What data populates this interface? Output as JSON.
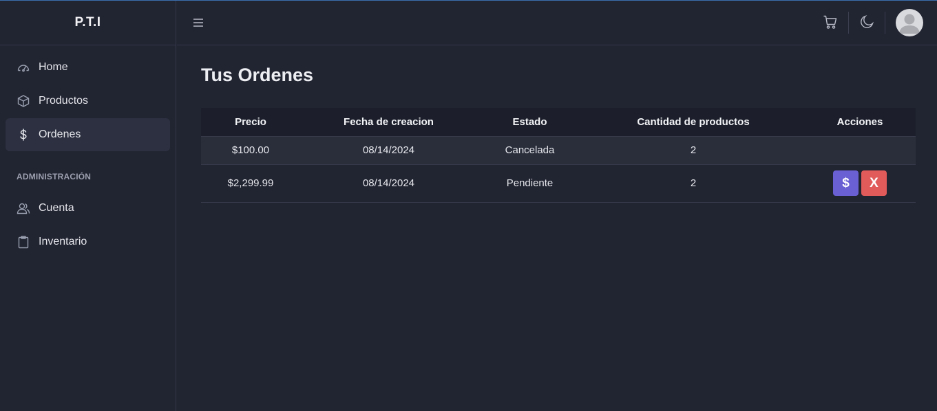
{
  "brand": "P.T.I",
  "sidebar": {
    "items": [
      {
        "label": "Home",
        "icon": "dashboard-gauge-icon",
        "active": false
      },
      {
        "label": "Productos",
        "icon": "cube-icon",
        "active": false
      },
      {
        "label": "Ordenes",
        "icon": "dollar-icon",
        "active": true
      }
    ],
    "section_title": "ADMINISTRACIÓN",
    "admin_items": [
      {
        "label": "Cuenta",
        "icon": "users-icon"
      },
      {
        "label": "Inventario",
        "icon": "clipboard-icon"
      }
    ]
  },
  "topbar": {
    "menu_icon": "hamburger-icon",
    "cart_icon": "cart-icon",
    "theme_icon": "moon-icon",
    "avatar_icon": "user-avatar-icon"
  },
  "main": {
    "title": "Tus Ordenes",
    "table": {
      "headers": [
        "Precio",
        "Fecha de creacion",
        "Estado",
        "Cantidad de productos",
        "Acciones"
      ],
      "rows": [
        {
          "precio": "$100.00",
          "fecha": "08/14/2024",
          "estado": "Cancelada",
          "cantidad": "2",
          "actions": []
        },
        {
          "precio": "$2,299.99",
          "fecha": "08/14/2024",
          "estado": "Pendiente",
          "cantidad": "2",
          "actions": [
            "$",
            "X"
          ]
        }
      ]
    }
  },
  "colors": {
    "background": "#212431",
    "active_nav": "#2c3040",
    "pay_button": "#6a5fd3",
    "cancel_button": "#e15b5b"
  }
}
